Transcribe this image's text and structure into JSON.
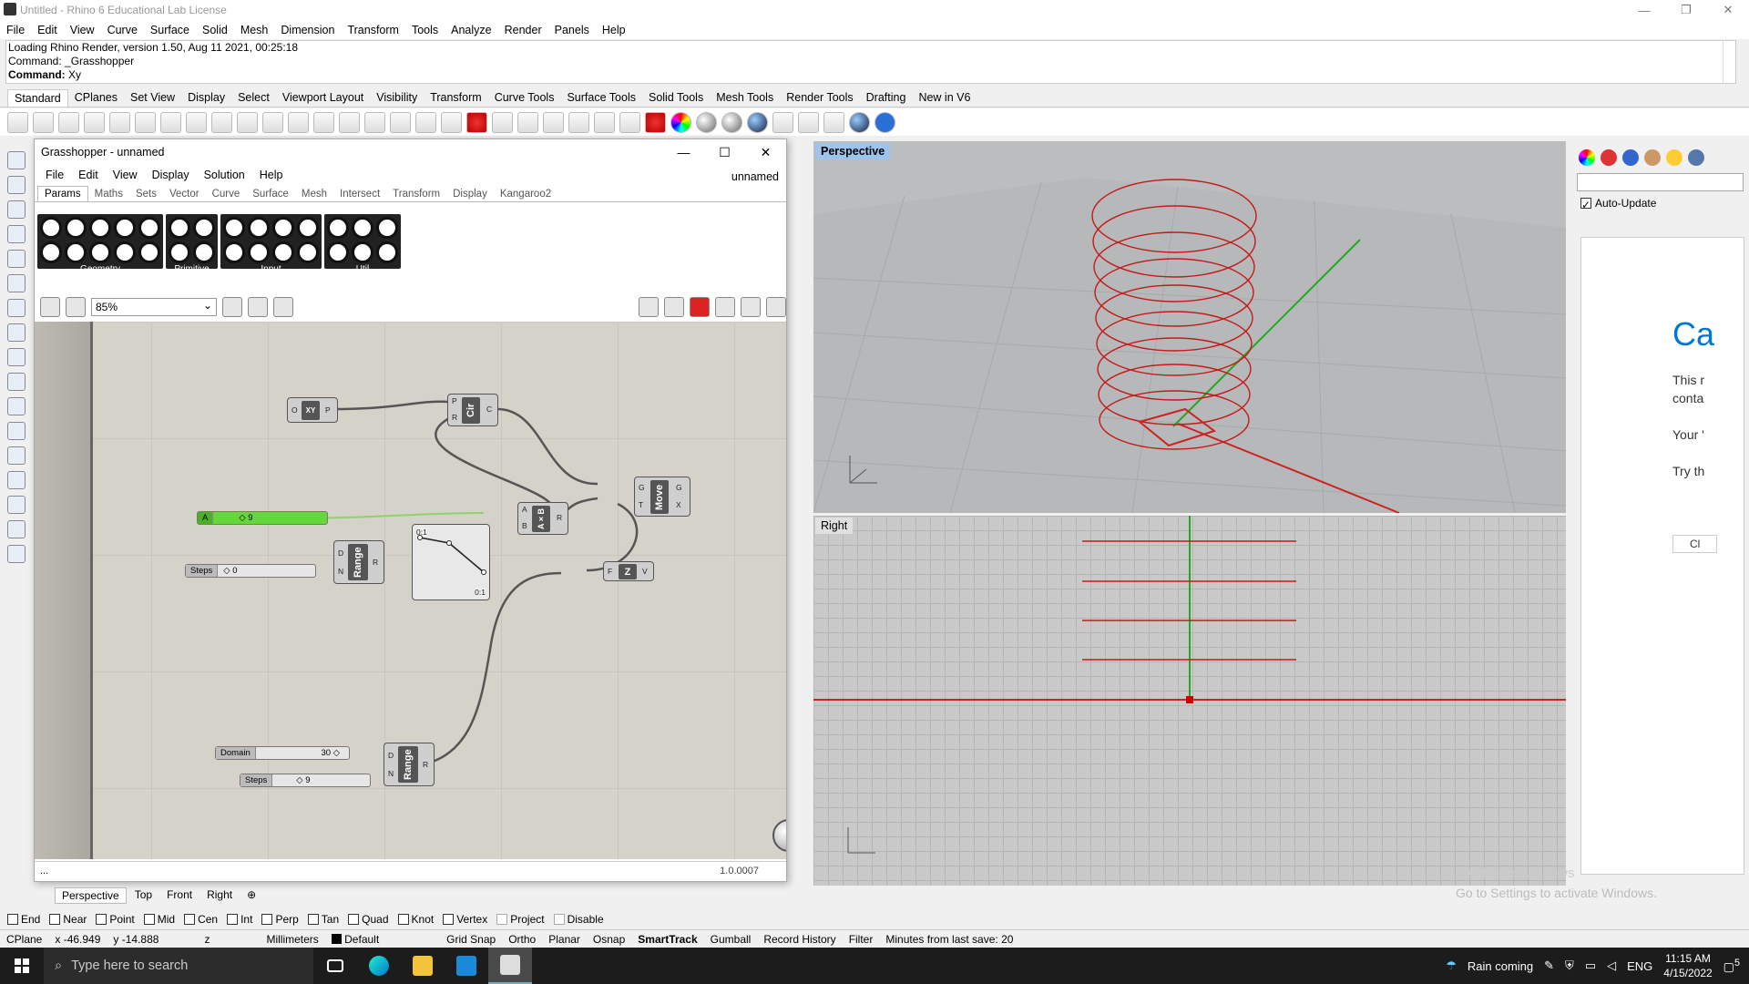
{
  "window": {
    "title": "Untitled - Rhino 6 Educational Lab License"
  },
  "menu": [
    "File",
    "Edit",
    "View",
    "Curve",
    "Surface",
    "Solid",
    "Mesh",
    "Dimension",
    "Transform",
    "Tools",
    "Analyze",
    "Render",
    "Panels",
    "Help"
  ],
  "command_history": [
    "Loading Rhino Render, version 1.50, Aug 11 2021, 00:25:18",
    "Command: _Grasshopper"
  ],
  "command_prompt": {
    "label": "Command:",
    "value": "Xy"
  },
  "toolbar_tabs": [
    "Standard",
    "CPlanes",
    "Set View",
    "Display",
    "Select",
    "Viewport Layout",
    "Visibility",
    "Transform",
    "Curve Tools",
    "Surface Tools",
    "Solid Tools",
    "Mesh Tools",
    "Render Tools",
    "Drafting",
    "New in V6"
  ],
  "grasshopper": {
    "title": "Grasshopper - unnamed",
    "menu": [
      "File",
      "Edit",
      "View",
      "Display",
      "Solution",
      "Help"
    ],
    "filename": "unnamed",
    "tabs": [
      "Params",
      "Maths",
      "Sets",
      "Vector",
      "Curve",
      "Surface",
      "Mesh",
      "Intersect",
      "Transform",
      "Display",
      "Kangaroo2"
    ],
    "ribbon_groups": [
      "Geometry",
      "Primitive",
      "Input",
      "Util"
    ],
    "zoom": "85%",
    "version": "1.0.0007",
    "status_left": "...",
    "components": {
      "xy_core": "XY",
      "xy_in": "O",
      "xy_out": "P",
      "cir_core": "Cir",
      "cir_in1": "P",
      "cir_in2": "R",
      "cir_out": "C",
      "mult_core": "A×B",
      "mult_in1": "A",
      "mult_in2": "B",
      "mult_out": "R",
      "move_core": "Move",
      "move_in1": "G",
      "move_in2": "T",
      "move_out1": "G",
      "move_out2": "X",
      "range1_core": "Range",
      "range1_in1": "D",
      "range1_in2": "N",
      "range1_out": "R",
      "range2_core": "Range",
      "range2_in1": "D",
      "range2_in2": "N",
      "range2_out": "R",
      "z_core": "Z",
      "z_in": "F",
      "z_out": "V",
      "graph_top": "0:1",
      "graph_bottom": "0:1"
    },
    "sliders": {
      "green": {
        "name": "A",
        "value": "◇ 9"
      },
      "steps1": {
        "name": "Steps",
        "value": "◇ 0"
      },
      "domain": {
        "name": "Domain",
        "value": "30 ◇"
      },
      "steps2": {
        "name": "Steps",
        "value": "◇ 9"
      }
    }
  },
  "viewports": {
    "perspective": "Perspective",
    "right": "Right"
  },
  "viewport_tabs": [
    "Perspective",
    "Top",
    "Front",
    "Right"
  ],
  "right_panel": {
    "auto_update": "Auto-Update",
    "heading_fragment": "Ca",
    "line1a": "This r",
    "line1b": "conta",
    "line2": "Your '",
    "line3": "Try th",
    "button_fragment": "Cl",
    "watermark1": "Activate Windows",
    "watermark2": "Go to Settings to activate Windows."
  },
  "osnaps": [
    "End",
    "Near",
    "Point",
    "Mid",
    "Cen",
    "Int",
    "Perp",
    "Tan",
    "Quad",
    "Knot",
    "Vertex",
    "Project",
    "Disable"
  ],
  "status": {
    "cplane": "CPlane",
    "x": "x -46.949",
    "y": "y -14.888",
    "z": "z",
    "units": "Millimeters",
    "layer": "Default",
    "toggles": [
      "Grid Snap",
      "Ortho",
      "Planar",
      "Osnap",
      "SmartTrack",
      "Gumball",
      "Record History",
      "Filter"
    ],
    "save": "Minutes from last save: 20"
  },
  "taskbar": {
    "search_placeholder": "Type here to search",
    "weather": "Rain coming",
    "lang": "ENG",
    "time": "11:15 AM",
    "date": "4/15/2022",
    "notif": "5"
  },
  "colors": {
    "accent": "#9ec4ec",
    "curve": "#d11",
    "green_slider": "#5fd82c"
  }
}
